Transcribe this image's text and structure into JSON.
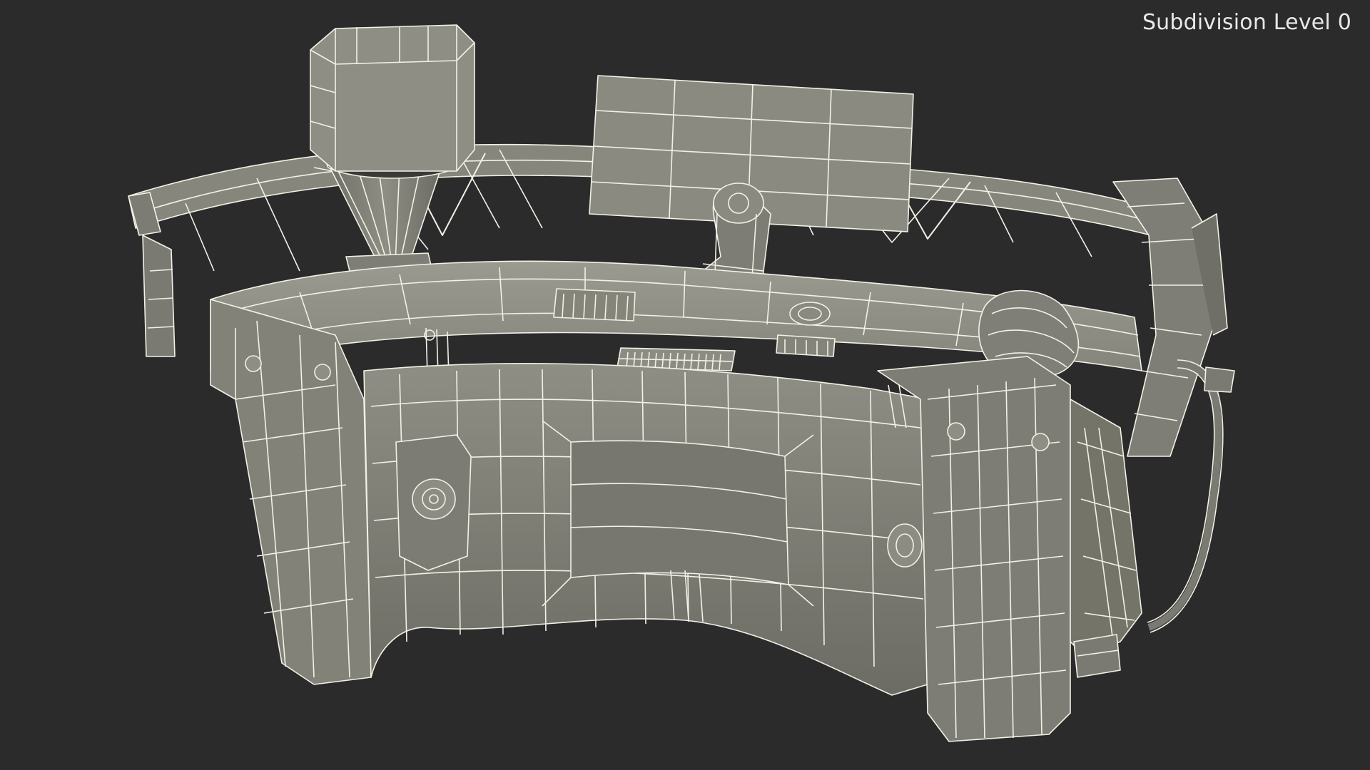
{
  "viewport": {
    "overlay_label": "Subdivision Level 0",
    "background_color": "#2b2b2b",
    "model_fill": "#8a8a80",
    "model_shade": "#6f6f66",
    "model_dark": "#5a5a52",
    "wire_color": "#f2f1e6",
    "model": "sci-fi control console wireframe"
  }
}
